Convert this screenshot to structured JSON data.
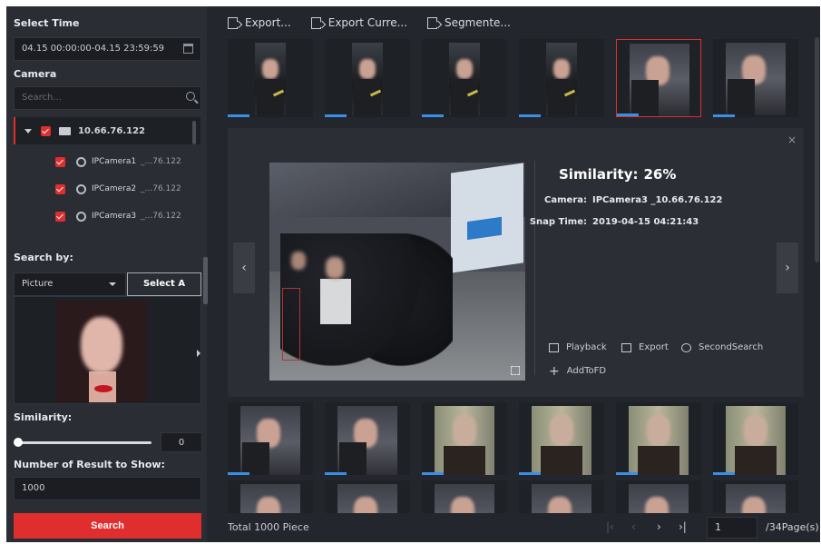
{
  "left": {
    "select_time_title": "Select Time",
    "time_range": "04.15 00:00:00-04.15 23:59:59",
    "camera_title": "Camera",
    "camera_search_placeholder": "Search...",
    "tree": {
      "root_label": "10.66.76.122",
      "cameras": [
        {
          "name": "IPCamera1",
          "ip": "_...76.122"
        },
        {
          "name": "IPCamera2",
          "ip": "_...76.122"
        },
        {
          "name": "IPCamera3",
          "ip": "_...76.122"
        }
      ]
    },
    "search_by_title": "Search by:",
    "search_by_value": "Picture",
    "select_picture_button": "Select A Pict...",
    "similarity_title": "Similarity:",
    "similarity_value": "0",
    "similarity_fraction": 0.0,
    "result_count_title": "Number of Result to Show:",
    "result_count_value": "1000",
    "search_button": "Search"
  },
  "toolbar": {
    "export": "Export...",
    "export_current": "Export Curre...",
    "segmented": "Segmente..."
  },
  "detail": {
    "similarity_label": "Similarity:",
    "similarity_value": "26%",
    "camera_key": "Camera:",
    "camera_value": "IPCamera3  _10.66.76.122",
    "snap_time_key": "Snap Time:",
    "snap_time_value": "2019-04-15 04:21:43",
    "actions": {
      "playback": "Playback",
      "export": "Export",
      "second_search": "SecondSearch",
      "add_to_fd": "AddToFD"
    },
    "close": "×",
    "prev": "‹",
    "next": "›"
  },
  "footer": {
    "total": "Total 1000 Piece",
    "page_input": "1",
    "page_total": "/34Page(s)"
  },
  "colors": {
    "accent_red": "#e02e2e",
    "progress_blue": "#3a8ee6",
    "background": "#23262c"
  },
  "icons": [
    "calendar-icon",
    "search-icon",
    "folder-icon",
    "camera-icon",
    "export-icon",
    "playback-icon",
    "magnifier-icon",
    "plus-icon",
    "close-icon",
    "fullscreen-icon"
  ]
}
